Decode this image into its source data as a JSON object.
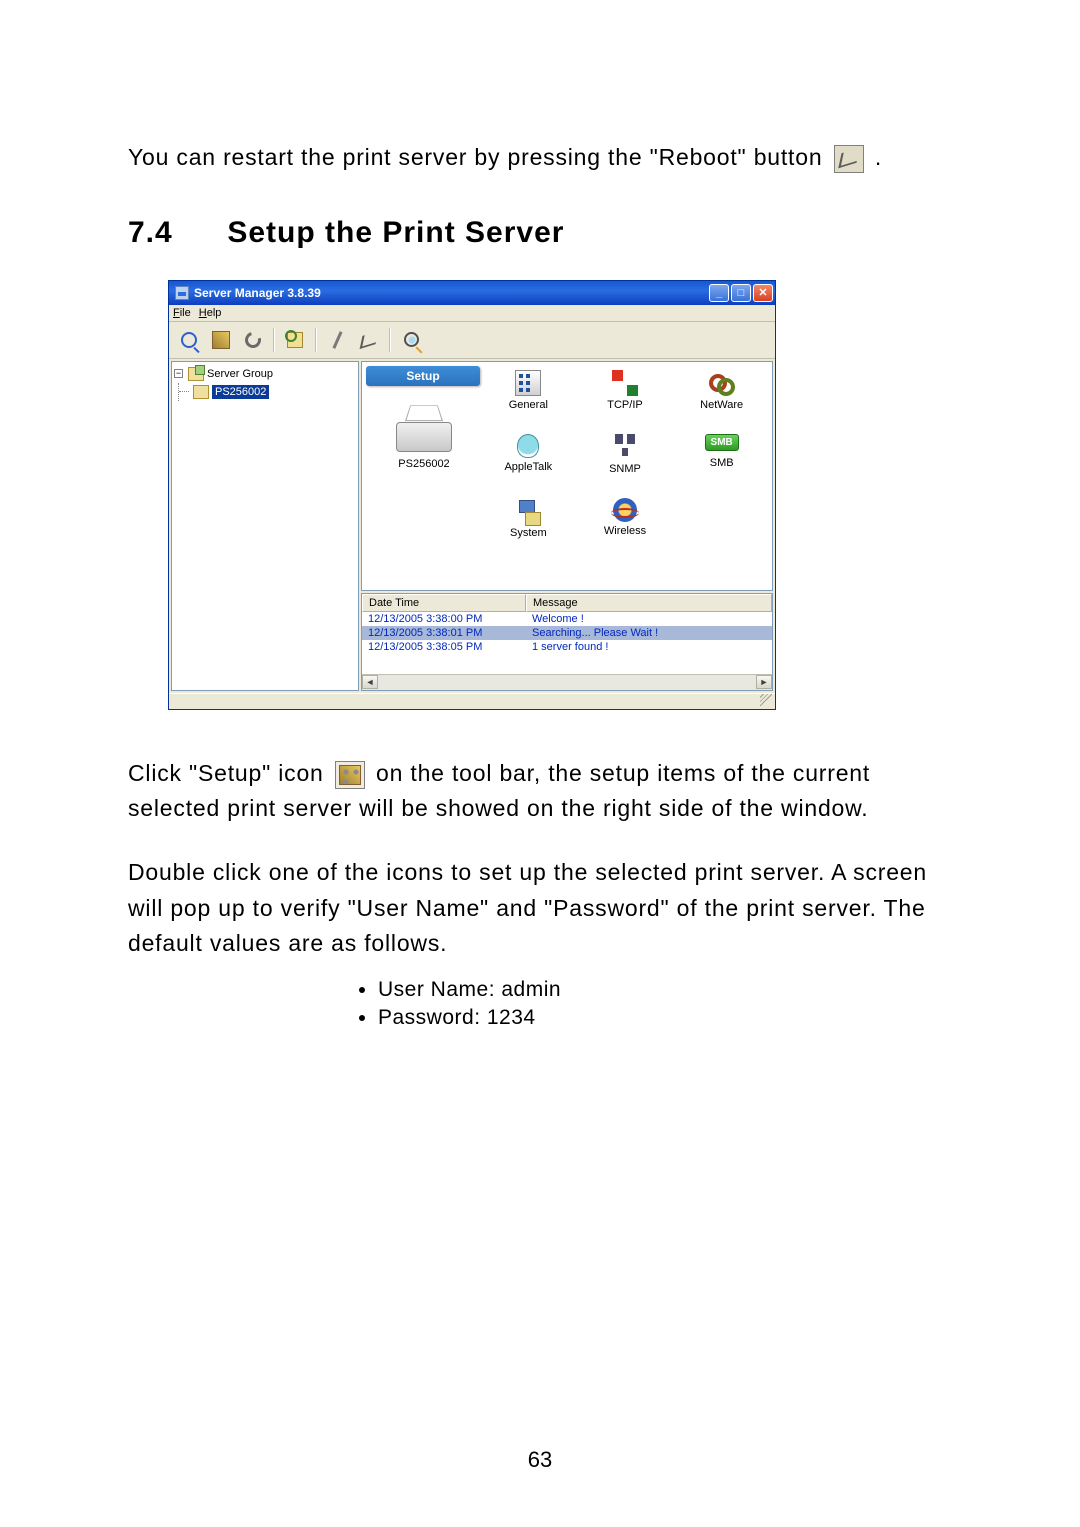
{
  "para1_pre": "You can restart the print server by pressing the \"Reboot\" button ",
  "para1_post": ".",
  "section": {
    "num": "7.4",
    "title": "Setup the Print Server"
  },
  "window": {
    "title": "Server Manager 3.8.39",
    "menus": {
      "file": "File",
      "help": "Help"
    },
    "tree": {
      "root": "Server Group",
      "selected": "PS256002"
    },
    "setup_banner": "Setup",
    "device_label": "PS256002",
    "icons": {
      "general": "General",
      "tcpip": "TCP/IP",
      "netware": "NetWare",
      "appletalk": "AppleTalk",
      "snmp": "SNMP",
      "smb_badge": "SMB",
      "smb": "SMB",
      "system": "System",
      "wireless": "Wireless"
    },
    "log": {
      "headers": {
        "dt": "Date Time",
        "msg": "Message"
      },
      "rows": [
        {
          "dt": "12/13/2005 3:38:00 PM",
          "msg": "Welcome !"
        },
        {
          "dt": "12/13/2005 3:38:01 PM",
          "msg": "Searching... Please Wait !"
        },
        {
          "dt": "12/13/2005 3:38:05 PM",
          "msg": "1 server found !"
        }
      ]
    }
  },
  "para2_pre": "Click \"Setup\" icon ",
  "para2_post": " on the tool bar, the setup items of the current selected print server will be showed on the right side of the window.",
  "para3": "Double click one of the icons to set up the selected print server. A screen will pop up to verify \"User Name\" and \"Password\" of the print server. The default values are as follows.",
  "bullets": {
    "b1": "User Name: admin",
    "b2": "Password: 1234"
  },
  "page_number": "63"
}
